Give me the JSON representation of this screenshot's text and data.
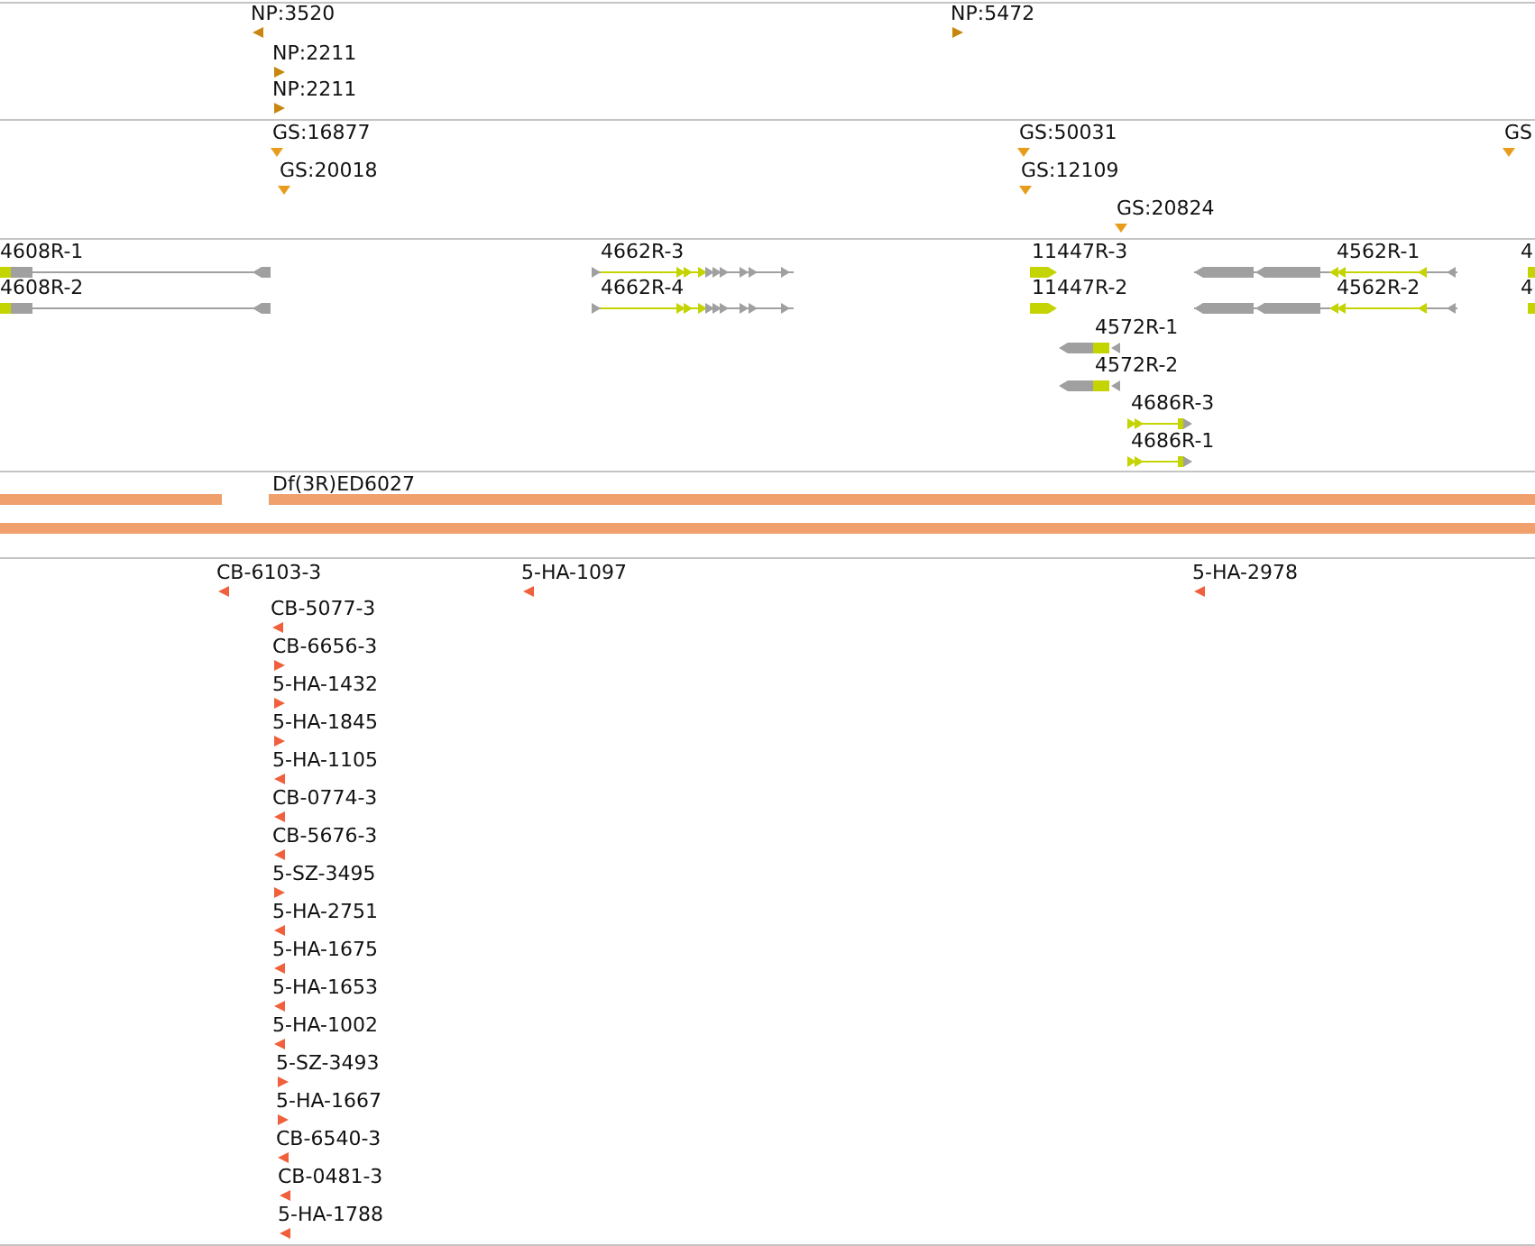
{
  "tracks": [
    {
      "kind": "features",
      "features": [
        {
          "label": "NP:3520",
          "reverse": true
        },
        {
          "label": "NP:2211",
          "reverse": false
        },
        {
          "label": "NP:2211",
          "reverse": false
        },
        {
          "label": "NP:5472",
          "reverse": false
        }
      ]
    },
    {
      "kind": "unstranded_features",
      "features": [
        {
          "label": "GS:16877"
        },
        {
          "label": "GS:20018"
        },
        {
          "label": "GS:50031"
        },
        {
          "label": "GS:12109"
        },
        {
          "label": "GS:20824"
        },
        {
          "label": "GS"
        }
      ]
    },
    {
      "kind": "transcripts",
      "transcripts": [
        {
          "label": "4608R-1",
          "reverse": true
        },
        {
          "label": "4608R-2",
          "reverse": true
        },
        {
          "label": "4662R-3",
          "reverse": false
        },
        {
          "label": "4662R-4",
          "reverse": false
        },
        {
          "label": "11447R-3",
          "reverse": false
        },
        {
          "label": "11447R-2",
          "reverse": false
        },
        {
          "label": "4562R-1",
          "reverse": true
        },
        {
          "label": "4562R-2",
          "reverse": true
        },
        {
          "label": "4"
        },
        {
          "label": "4"
        },
        {
          "label": "4572R-1",
          "reverse": true
        },
        {
          "label": "4572R-2",
          "reverse": true
        },
        {
          "label": "4686R-3",
          "reverse": false
        },
        {
          "label": "4686R-1",
          "reverse": false
        }
      ]
    },
    {
      "kind": "deletions",
      "items": [
        {
          "kind": "bar"
        },
        {
          "kind": "labeled_bar",
          "label": "Df(3R)ED6027"
        },
        {
          "kind": "bar"
        }
      ]
    },
    {
      "kind": "features",
      "features": [
        {
          "label": "CB-6103-3",
          "reverse": true
        },
        {
          "label": "5-HA-1097",
          "reverse": true
        },
        {
          "label": "5-HA-2978",
          "reverse": true
        },
        {
          "label": "CB-5077-3",
          "reverse": true
        },
        {
          "label": "CB-6656-3",
          "reverse": false
        },
        {
          "label": "5-HA-1432",
          "reverse": false
        },
        {
          "label": "5-HA-1845",
          "reverse": false
        },
        {
          "label": "5-HA-1105",
          "reverse": true
        },
        {
          "label": "CB-0774-3",
          "reverse": true
        },
        {
          "label": "CB-5676-3",
          "reverse": true
        },
        {
          "label": "5-SZ-3495",
          "reverse": false
        },
        {
          "label": "5-HA-2751",
          "reverse": true
        },
        {
          "label": "5-HA-1675",
          "reverse": true
        },
        {
          "label": "5-HA-1653",
          "reverse": true
        },
        {
          "label": "5-HA-1002",
          "reverse": true
        },
        {
          "label": "5-SZ-3493",
          "reverse": false
        },
        {
          "label": "5-HA-1667",
          "reverse": false
        },
        {
          "label": "CB-6540-3",
          "reverse": true
        },
        {
          "label": "CB-0481-3",
          "reverse": true
        },
        {
          "label": "5-HA-1788",
          "reverse": true
        }
      ]
    }
  ]
}
